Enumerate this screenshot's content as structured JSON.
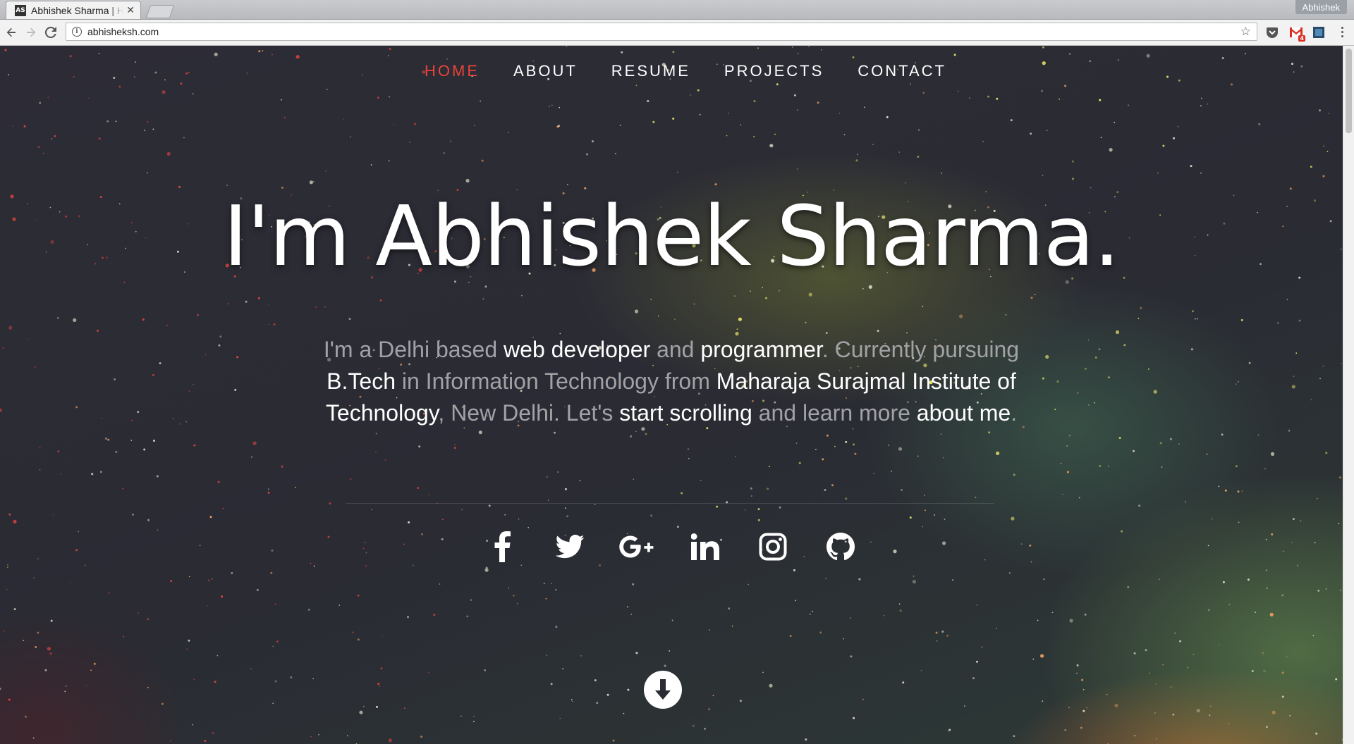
{
  "browser": {
    "tab_title": "Abhishek Sharma | Home",
    "favicon_text": "AS",
    "url": "abhisheksh.com",
    "profile_name": "Abhishek",
    "gmail_badge": "4"
  },
  "nav": {
    "items": [
      {
        "label": "HOME",
        "active": true
      },
      {
        "label": "ABOUT",
        "active": false
      },
      {
        "label": "RESUME",
        "active": false
      },
      {
        "label": "PROJECTS",
        "active": false
      },
      {
        "label": "CONTACT",
        "active": false
      }
    ],
    "active_color": "#e8433a"
  },
  "hero": {
    "title": "I'm Abhishek Sharma.",
    "intro": [
      {
        "text": "I'm a Delhi based ",
        "highlight": false
      },
      {
        "text": "web developer",
        "highlight": true
      },
      {
        "text": " and ",
        "highlight": false
      },
      {
        "text": "programmer",
        "highlight": true
      },
      {
        "text": ". Currently pursuing ",
        "highlight": false
      },
      {
        "text": "B.Tech",
        "highlight": true
      },
      {
        "text": " in Information Technology from ",
        "highlight": false
      },
      {
        "text": "Maharaja Surajmal Institute of Technology",
        "highlight": true
      },
      {
        "text": ", New Delhi. Let's ",
        "highlight": false
      },
      {
        "text": "start scrolling",
        "highlight": true
      },
      {
        "text": " and learn more ",
        "highlight": false
      },
      {
        "text": "about me",
        "highlight": true
      },
      {
        "text": ".",
        "highlight": false
      }
    ]
  },
  "social": [
    {
      "name": "facebook-icon"
    },
    {
      "name": "twitter-icon"
    },
    {
      "name": "google-plus-icon"
    },
    {
      "name": "linkedin-icon"
    },
    {
      "name": "instagram-icon"
    },
    {
      "name": "github-icon"
    }
  ],
  "colors": {
    "background": "#2b2b33",
    "text_muted": "#a2a2a6",
    "text_highlight": "#ffffff"
  }
}
